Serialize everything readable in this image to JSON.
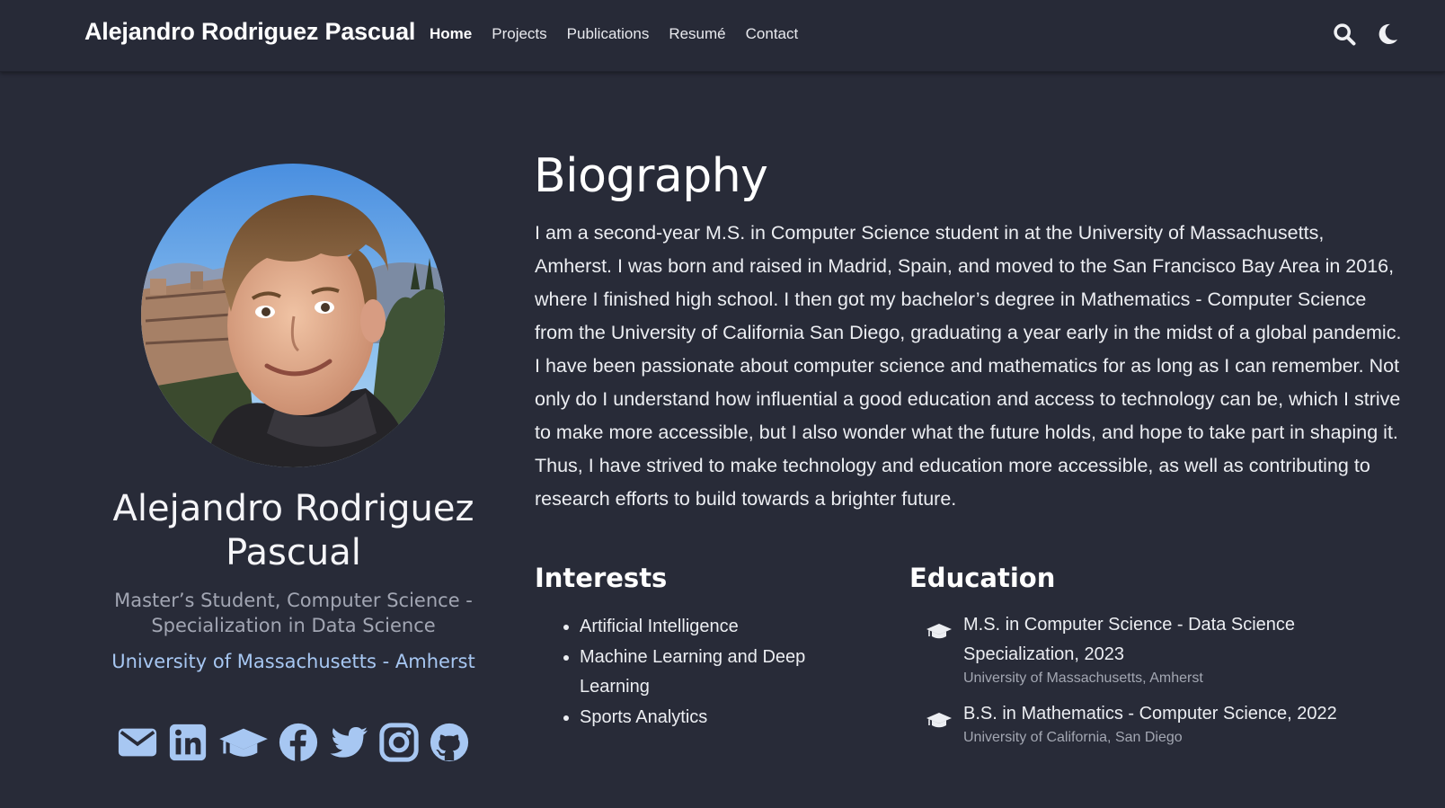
{
  "navbar": {
    "brand": "Alejandro Rodriguez Pascual",
    "links": [
      {
        "label": "Home",
        "active": true
      },
      {
        "label": "Projects"
      },
      {
        "label": "Publications"
      },
      {
        "label": "Resumé"
      },
      {
        "label": "Contact"
      }
    ],
    "icons": [
      "search-icon",
      "moon-icon"
    ]
  },
  "profile": {
    "name_line1": "Alejandro Rodriguez",
    "name_line2": "Pascual",
    "role_line1": "Master’s Student, Computer Science -",
    "role_line2": "Specialization in Data Science",
    "organization": "University of Massachusetts - Amherst",
    "socials": [
      "envelope-icon",
      "linkedin-icon",
      "graduation-cap-icon",
      "facebook-icon",
      "twitter-icon",
      "instagram-icon",
      "github-icon"
    ]
  },
  "biography": {
    "heading": "Biography",
    "text": "I am a second-year M.S. in Computer Science student in at the University of Massachusetts, Amherst. I was born and raised in Madrid, Spain, and moved to the San Francisco Bay Area in 2016, where I finished high school. I then got my bachelor’s degree in Mathematics - Computer Science from the University of California San Diego, graduating a year early in the midst of a global pandemic. I have been passionate about computer science and mathematics for as long as I can remember. Not only do I understand how influential a good education and access to technology can be, which I strive to make more accessible, but I also wonder what the future holds, and hope to take part in shaping it. Thus, I have strived to make technology and education more accessible, as well as contributing to research efforts to build towards a brighter future."
  },
  "interests": {
    "title": "Interests",
    "items": [
      "Artificial Intelligence",
      "Machine Learning and Deep Learning",
      "Sports Analytics"
    ]
  },
  "education": {
    "title": "Education",
    "items": [
      {
        "degree": "M.S. in Computer Science - Data Science Specialization, 2023",
        "school": "University of Massachusetts, Amherst"
      },
      {
        "degree": "B.S. in Mathematics - Computer Science, 2022",
        "school": "University of California, San Diego"
      }
    ]
  },
  "colors": {
    "background": "#282b38",
    "accent_link": "#a7c7f2",
    "muted_text": "#a2a6b3"
  }
}
